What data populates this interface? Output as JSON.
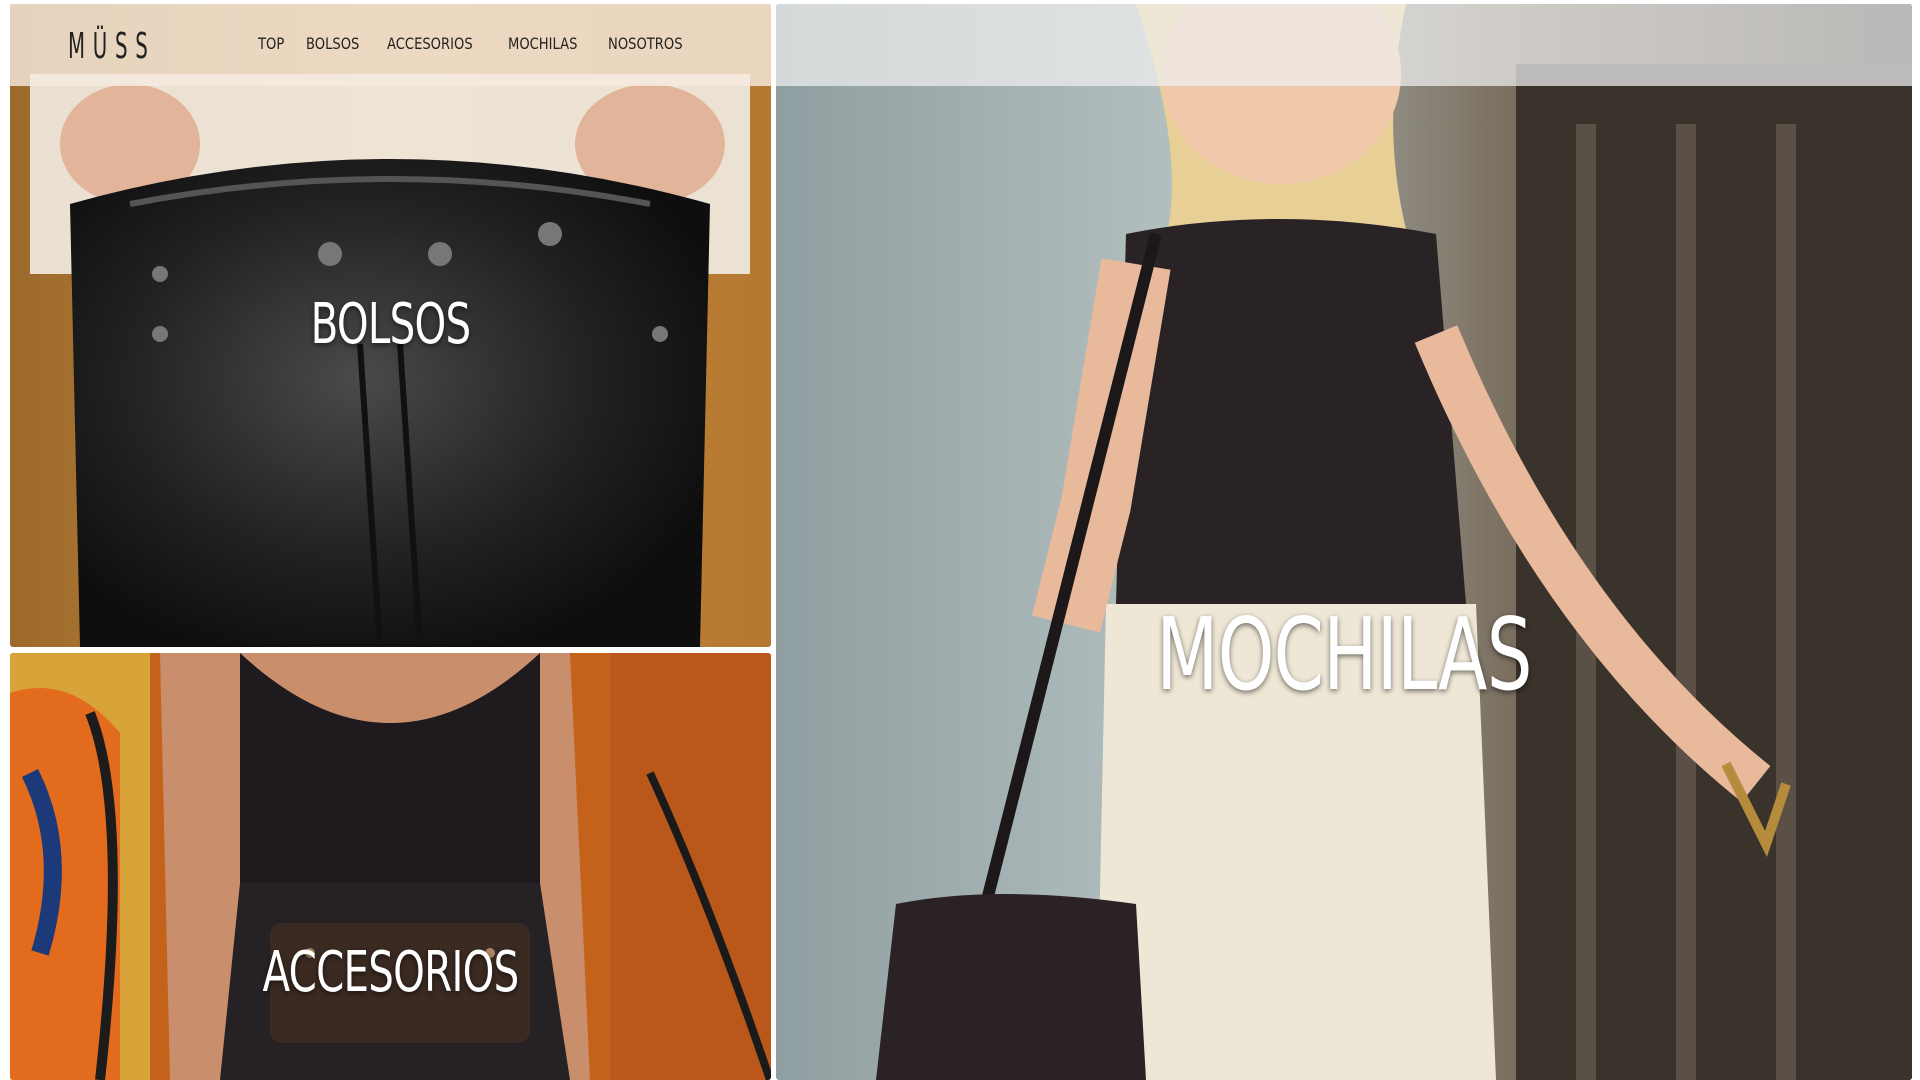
{
  "header": {
    "logo": "MÜSS",
    "nav": [
      {
        "label": "TOP"
      },
      {
        "label": "BOLSOS"
      },
      {
        "label": "ACCESORIOS"
      },
      {
        "label": "MOCHILAS"
      },
      {
        "label": "NOSOTROS"
      }
    ]
  },
  "tiles": {
    "bolsos": {
      "label": "BOLSOS"
    },
    "accesorios": {
      "label": "ACCESORIOS"
    },
    "mochilas": {
      "label": "MOCHILAS"
    }
  }
}
